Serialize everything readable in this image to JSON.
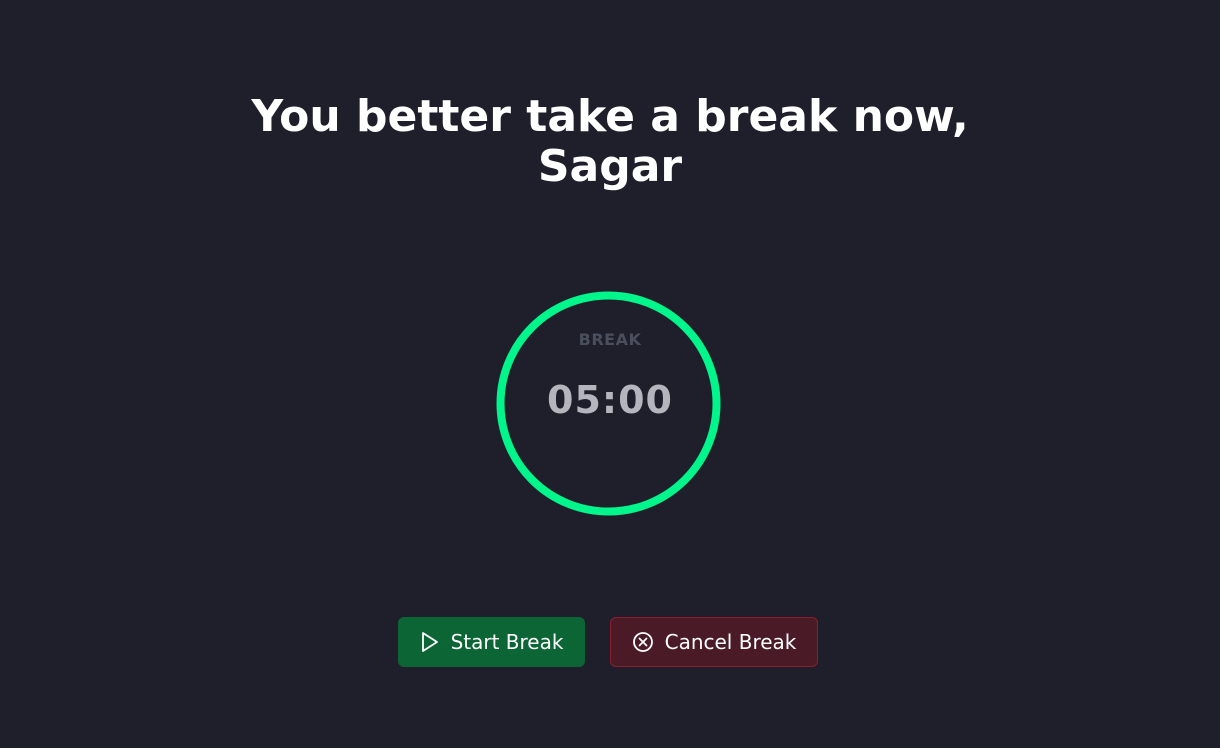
{
  "heading": {
    "line1": "You better take a break now,",
    "line2": "Sagar"
  },
  "timer": {
    "label": "BREAK",
    "time": "05:00",
    "ring_color": "#00f58a",
    "remaining_fraction": 1.0
  },
  "actions": {
    "start": {
      "label": "Start Break",
      "icon": "play-icon",
      "color": "#0c6535"
    },
    "cancel": {
      "label": "Cancel Break",
      "icon": "close-circle-icon",
      "color": "#4a1b26"
    }
  }
}
